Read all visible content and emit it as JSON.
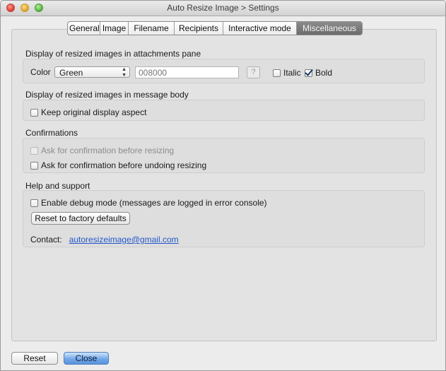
{
  "window": {
    "title": "Auto Resize Image > Settings"
  },
  "tabs": [
    {
      "label": "General",
      "active": false
    },
    {
      "label": "Image",
      "active": false
    },
    {
      "label": "Filename",
      "active": false
    },
    {
      "label": "Recipients",
      "active": false
    },
    {
      "label": "Interactive mode",
      "active": false
    },
    {
      "label": "Miscellaneous",
      "active": true
    }
  ],
  "attachments_pane": {
    "title": "Display of resized images in attachments pane",
    "color_label": "Color",
    "color_select_value": "Green",
    "color_hex_placeholder": "008000",
    "help_label": "?",
    "italic_label": "Italic",
    "italic_checked": false,
    "bold_label": "Bold",
    "bold_checked": true
  },
  "message_body": {
    "title": "Display of resized images in message body",
    "keep_aspect_label": "Keep original display aspect",
    "keep_aspect_checked": false
  },
  "confirmations": {
    "title": "Confirmations",
    "before_resizing_label": "Ask for confirmation before resizing",
    "before_resizing_checked": false,
    "before_resizing_disabled": true,
    "before_undoing_label": "Ask for confirmation before undoing resizing",
    "before_undoing_checked": false
  },
  "help_support": {
    "title": "Help and support",
    "debug_label": "Enable debug mode (messages are logged in error console)",
    "debug_checked": false,
    "reset_factory_label": "Reset to factory defaults",
    "contact_label": "Contact:",
    "contact_email": "autoresizeimage@gmail.com"
  },
  "footer": {
    "reset_label": "Reset",
    "close_label": "Close"
  },
  "colors": {
    "accent": "#6ea4e6",
    "active_tab": "#7b7b7b",
    "link": "#2456c9"
  }
}
